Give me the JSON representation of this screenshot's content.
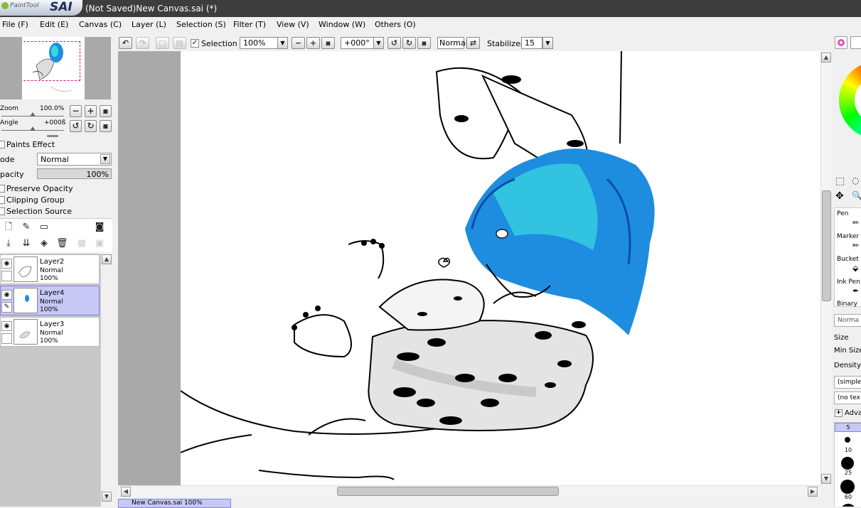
{
  "app": {
    "logo_small": "PaintTool",
    "logo_big": "SAI",
    "window_title": "(Not Saved)New Canvas.sai (*)"
  },
  "menu": [
    {
      "label": "File (F)"
    },
    {
      "label": "Edit (E)"
    },
    {
      "label": "Canvas (C)"
    },
    {
      "label": "Layer (L)"
    },
    {
      "label": "Selection (S)"
    },
    {
      "label": "Filter (T)"
    },
    {
      "label": "View (V)"
    },
    {
      "label": "Window (W)"
    },
    {
      "label": "Others (O)"
    }
  ],
  "navigator": {
    "zoom_label": "Zoom",
    "zoom_value": "100.0%",
    "zoom_fraction": 0.5,
    "angle_label": "Angle",
    "angle_value": "+000ß",
    "angle_fraction": 0.5
  },
  "layer_props": {
    "paints_effect": "Paints Effect",
    "mode_label": "ode",
    "mode_value": "Normal",
    "opacity_label": "pacity",
    "opacity_value": "100%",
    "opacity_fraction": 1.0,
    "preserve_opacity": "Preserve Opacity",
    "clipping_group": "Clipping Group",
    "selection_source": "Selection Source"
  },
  "layers": [
    {
      "name": "Layer2",
      "mode": "Normal",
      "opacity": "100%",
      "selected": false
    },
    {
      "name": "Layer4",
      "mode": "Normal",
      "opacity": "100%",
      "selected": true
    },
    {
      "name": "Layer3",
      "mode": "Normal",
      "opacity": "100%",
      "selected": false
    }
  ],
  "toolbar": {
    "selection_label": "Selection",
    "selection_checked": true,
    "zoom_value": "100%",
    "angle_value": "+000°",
    "blend_value": "Normal",
    "stabilizer_label": "Stabilizer",
    "stabilizer_value": "15"
  },
  "status": {
    "tab_text": "New Canvas.sai 100%"
  },
  "tools": {
    "pen": "Pen",
    "marker": "Marker",
    "bucket": "Bucket",
    "ink_pen": "Ink Pen",
    "binary": "Binary",
    "mode_box": "Norma",
    "size": "Size",
    "min_size": "Min Size",
    "density": "Density",
    "shape_box": "(simple",
    "texture_box": "(no tex",
    "advanced": "Adva"
  },
  "brush_sizes": [
    "5",
    "10",
    "25",
    "60"
  ],
  "colors": {
    "selection_highlight": "#c8c8f6",
    "title_bg": "#3d3d3d",
    "navigator_frame": "#d0157a",
    "hair_blue": "#1e8de0",
    "hair_cyan": "#38d6e0"
  }
}
